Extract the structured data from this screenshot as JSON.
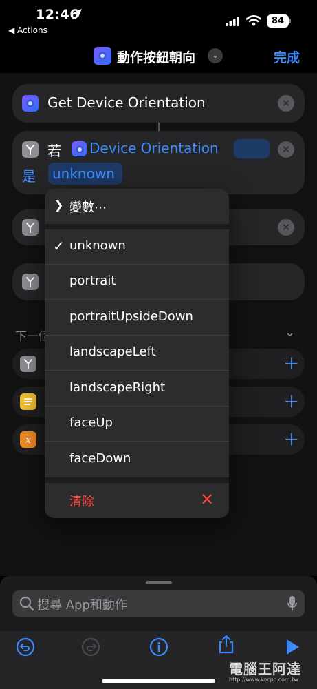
{
  "status": {
    "time": "12:46",
    "back_app": "Actions",
    "battery": "84"
  },
  "nav": {
    "title": "動作按鈕朝向",
    "done": "完成"
  },
  "actions": {
    "get_orientation": {
      "title": "Get Device Orientation"
    },
    "if_block": {
      "if_word": "若",
      "variable": "Device Orientation",
      "is_word": "是",
      "value": "unknown"
    }
  },
  "section": {
    "label": "下一個"
  },
  "menu": {
    "variables": "變數⋯",
    "options": [
      "unknown",
      "portrait",
      "portraitUpsideDown",
      "landscapeLeft",
      "landscapeRight",
      "faceUp",
      "faceDown"
    ],
    "selected": "unknown",
    "clear": "清除"
  },
  "search": {
    "placeholder": "搜尋 App和動作"
  },
  "colors": {
    "accent": "#3b8bff",
    "destructive": "#ff453a"
  },
  "watermark": {
    "text": "電腦王阿達",
    "url": "http://www.kocpc.com.tw"
  }
}
